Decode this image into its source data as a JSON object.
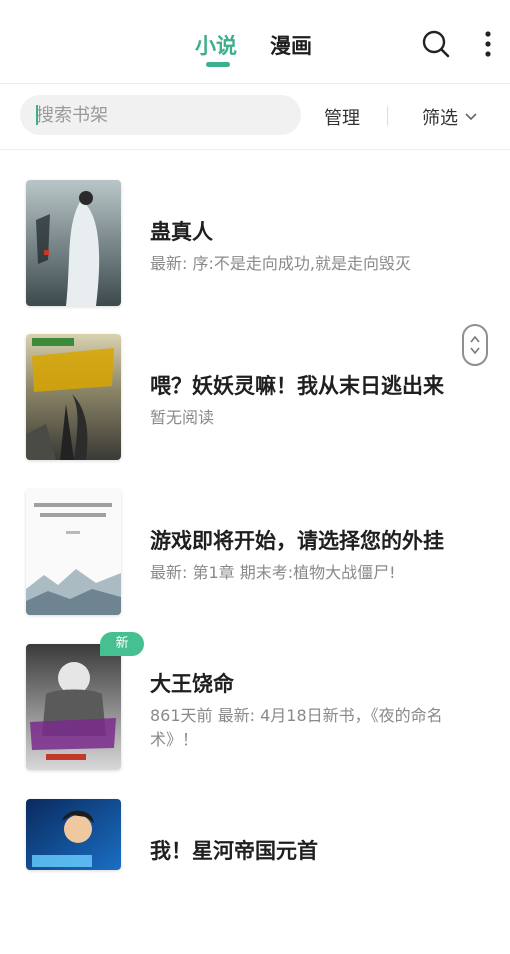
{
  "header": {
    "tabs": [
      {
        "label": "小说",
        "active": true
      },
      {
        "label": "漫画",
        "active": false
      }
    ],
    "icons": [
      "search-icon",
      "more-vertical-icon"
    ]
  },
  "toolbar": {
    "search_placeholder": "搜索书架",
    "manage_label": "管理",
    "filter_label": "筛选"
  },
  "books": [
    {
      "title": "蛊真人",
      "subtitle": "最新: 序:不是走向成功,就是走向毁灭",
      "badge": ""
    },
    {
      "title": "喂？妖妖灵嘛！我从末日逃出来",
      "subtitle": "暂无阅读",
      "badge": ""
    },
    {
      "title": "游戏即将开始，请选择您的外挂",
      "subtitle": "最新: 第1章 期末考:植物大战僵尸!",
      "badge": ""
    },
    {
      "title": "大王饶命",
      "subtitle": "861天前 最新: 4月18日新书，《夜的命名术》！",
      "badge": "新"
    },
    {
      "title": "我！星河帝国元首",
      "subtitle": "",
      "badge": ""
    }
  ],
  "colors": {
    "accent": "#3fae8e",
    "badge": "#46c090"
  }
}
